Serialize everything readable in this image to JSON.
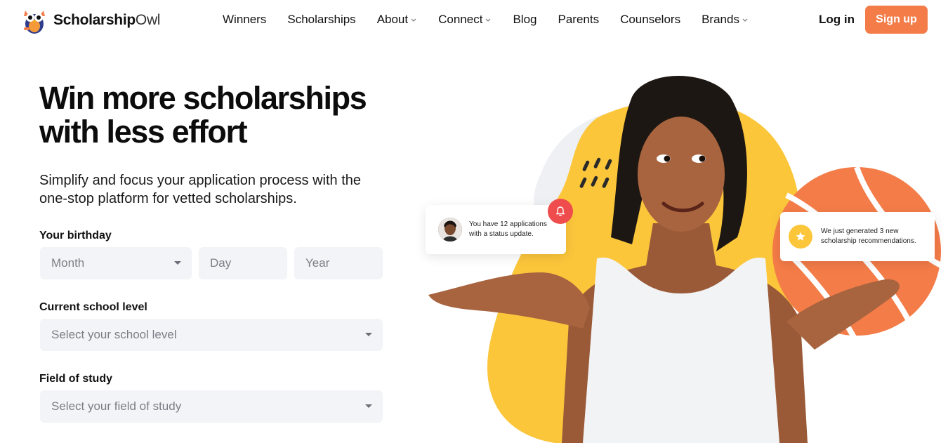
{
  "brand": {
    "name_bold": "Scholarship",
    "name_light": "Owl"
  },
  "nav": {
    "items": [
      {
        "label": "Winners",
        "dropdown": false
      },
      {
        "label": "Scholarships",
        "dropdown": false
      },
      {
        "label": "About",
        "dropdown": true
      },
      {
        "label": "Connect",
        "dropdown": true
      },
      {
        "label": "Blog",
        "dropdown": false
      },
      {
        "label": "Parents",
        "dropdown": false
      },
      {
        "label": "Counselors",
        "dropdown": false
      },
      {
        "label": "Brands",
        "dropdown": true
      }
    ],
    "login_label": "Log in",
    "signup_label": "Sign up"
  },
  "hero": {
    "title_line1": "Win more scholarships",
    "title_line2": "with less effort",
    "subtitle_line1": "Simplify and focus your application process with the",
    "subtitle_line2": "one-stop platform for vetted scholarships."
  },
  "form": {
    "birthday_label": "Your birthday",
    "month_placeholder": "Month",
    "day_placeholder": "Day",
    "year_placeholder": "Year",
    "school_level_label": "Current school level",
    "school_level_placeholder": "Select your school level",
    "field_of_study_label": "Field of study",
    "field_of_study_placeholder": "Select your field of study"
  },
  "notifications": {
    "status_line1": "You have 12 applications",
    "status_line2": "with a status update.",
    "reco_line1": "We just generated 3 new",
    "reco_line2": "scholarship recommendations."
  },
  "colors": {
    "accent": "#f47c48",
    "yellow": "#fcc63b",
    "alert_red": "#ef4d4d",
    "field_bg": "#f3f4f7"
  },
  "icons": [
    "owl-logo-icon",
    "chevron-down-icon",
    "caret-down-icon",
    "bell-icon",
    "star-icon"
  ]
}
